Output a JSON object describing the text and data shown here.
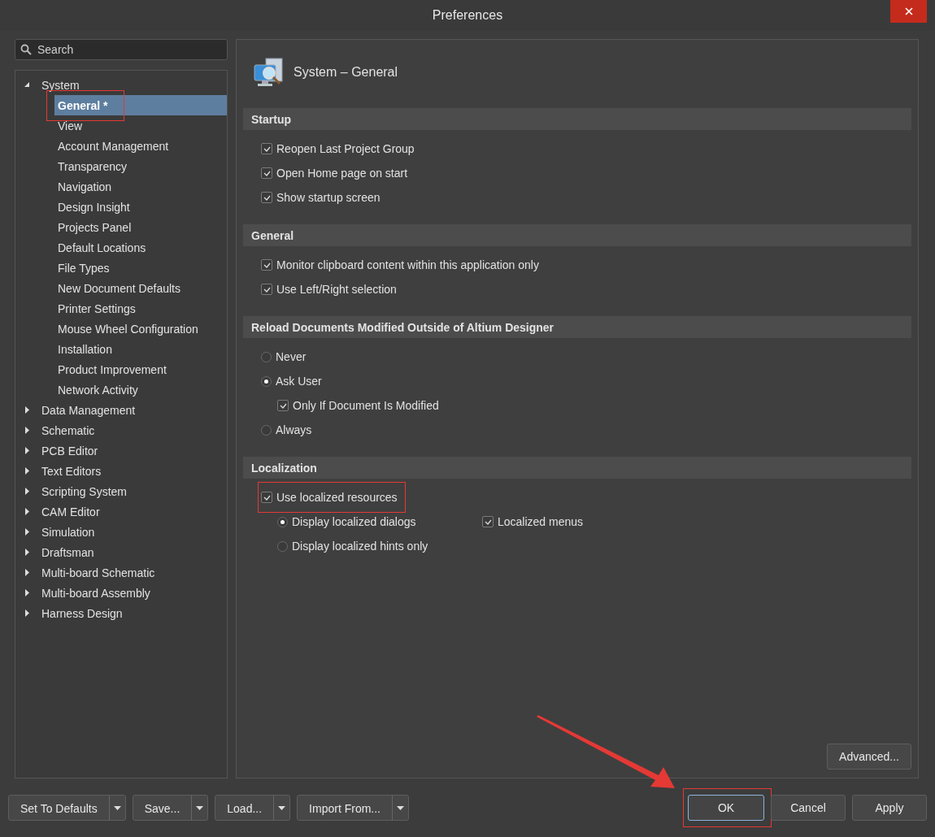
{
  "window": {
    "title": "Preferences"
  },
  "search": {
    "placeholder": "Search"
  },
  "tree": [
    {
      "label": "System",
      "expanded": true,
      "children": [
        {
          "label": "General *",
          "selected": true,
          "highlighted": true
        },
        {
          "label": "View",
          "selected": false,
          "highlighted": false
        },
        {
          "label": "Account Management",
          "selected": false,
          "highlighted": false
        },
        {
          "label": "Transparency",
          "selected": false,
          "highlighted": false
        },
        {
          "label": "Navigation",
          "selected": false,
          "highlighted": false
        },
        {
          "label": "Design Insight",
          "selected": false,
          "highlighted": false
        },
        {
          "label": "Projects Panel",
          "selected": false,
          "highlighted": false
        },
        {
          "label": "Default Locations",
          "selected": false,
          "highlighted": false
        },
        {
          "label": "File Types",
          "selected": false,
          "highlighted": false
        },
        {
          "label": "New Document Defaults",
          "selected": false,
          "highlighted": false
        },
        {
          "label": "Printer Settings",
          "selected": false,
          "highlighted": false
        },
        {
          "label": "Mouse Wheel Configuration",
          "selected": false,
          "highlighted": false
        },
        {
          "label": "Installation",
          "selected": false,
          "highlighted": false
        },
        {
          "label": "Product Improvement",
          "selected": false,
          "highlighted": false
        },
        {
          "label": "Network Activity",
          "selected": false,
          "highlighted": false
        }
      ]
    },
    {
      "label": "Data Management",
      "expanded": false
    },
    {
      "label": "Schematic",
      "expanded": false
    },
    {
      "label": "PCB Editor",
      "expanded": false
    },
    {
      "label": "Text Editors",
      "expanded": false
    },
    {
      "label": "Scripting System",
      "expanded": false
    },
    {
      "label": "CAM Editor",
      "expanded": false
    },
    {
      "label": "Simulation",
      "expanded": false
    },
    {
      "label": "Draftsman",
      "expanded": false
    },
    {
      "label": "Multi-board Schematic",
      "expanded": false
    },
    {
      "label": "Multi-board Assembly",
      "expanded": false
    },
    {
      "label": "Harness Design",
      "expanded": false
    }
  ],
  "page": {
    "title": "System – General",
    "sections": [
      {
        "title": "Startup",
        "options": [
          {
            "kind": "checkbox",
            "label": "Reopen Last Project Group",
            "checked": true,
            "highlighted": false
          },
          {
            "kind": "checkbox",
            "label": "Open Home page on start",
            "checked": true,
            "highlighted": false
          },
          {
            "kind": "checkbox",
            "label": "Show startup screen",
            "checked": true,
            "highlighted": false
          }
        ]
      },
      {
        "title": "General",
        "options": [
          {
            "kind": "checkbox",
            "label": "Monitor clipboard content within this application only",
            "checked": true,
            "highlighted": false
          },
          {
            "kind": "checkbox",
            "label": "Use Left/Right selection",
            "checked": true,
            "highlighted": false
          }
        ]
      },
      {
        "title": "Reload Documents Modified Outside of Altium Designer",
        "options": [
          {
            "kind": "radio",
            "label": "Never",
            "checked": false,
            "highlighted": false
          },
          {
            "kind": "radio",
            "label": "Ask User",
            "checked": true,
            "highlighted": false,
            "children": [
              {
                "kind": "checkbox",
                "label": "Only If Document Is Modified",
                "checked": true
              }
            ]
          },
          {
            "kind": "radio",
            "label": "Always",
            "checked": false,
            "highlighted": false
          }
        ]
      },
      {
        "title": "Localization",
        "options": [
          {
            "kind": "checkbox",
            "label": "Use localized resources",
            "checked": true,
            "highlighted": true,
            "children": [
              {
                "kind": "radio",
                "label": "Display localized dialogs",
                "checked": true
              },
              {
                "kind": "checkbox",
                "label": "Localized menus",
                "checked": true
              },
              {
                "kind": "radio",
                "label": "Display localized hints only",
                "checked": false
              }
            ]
          }
        ]
      }
    ],
    "advanced_button": "Advanced..."
  },
  "footer_left": [
    {
      "label": "Set To Defaults"
    },
    {
      "label": "Save..."
    },
    {
      "label": "Load..."
    },
    {
      "label": "Import From..."
    }
  ],
  "footer_right": [
    {
      "label": "OK",
      "default": true,
      "highlighted": true
    },
    {
      "label": "Cancel",
      "default": false,
      "highlighted": false
    },
    {
      "label": "Apply",
      "default": false,
      "highlighted": false
    }
  ]
}
